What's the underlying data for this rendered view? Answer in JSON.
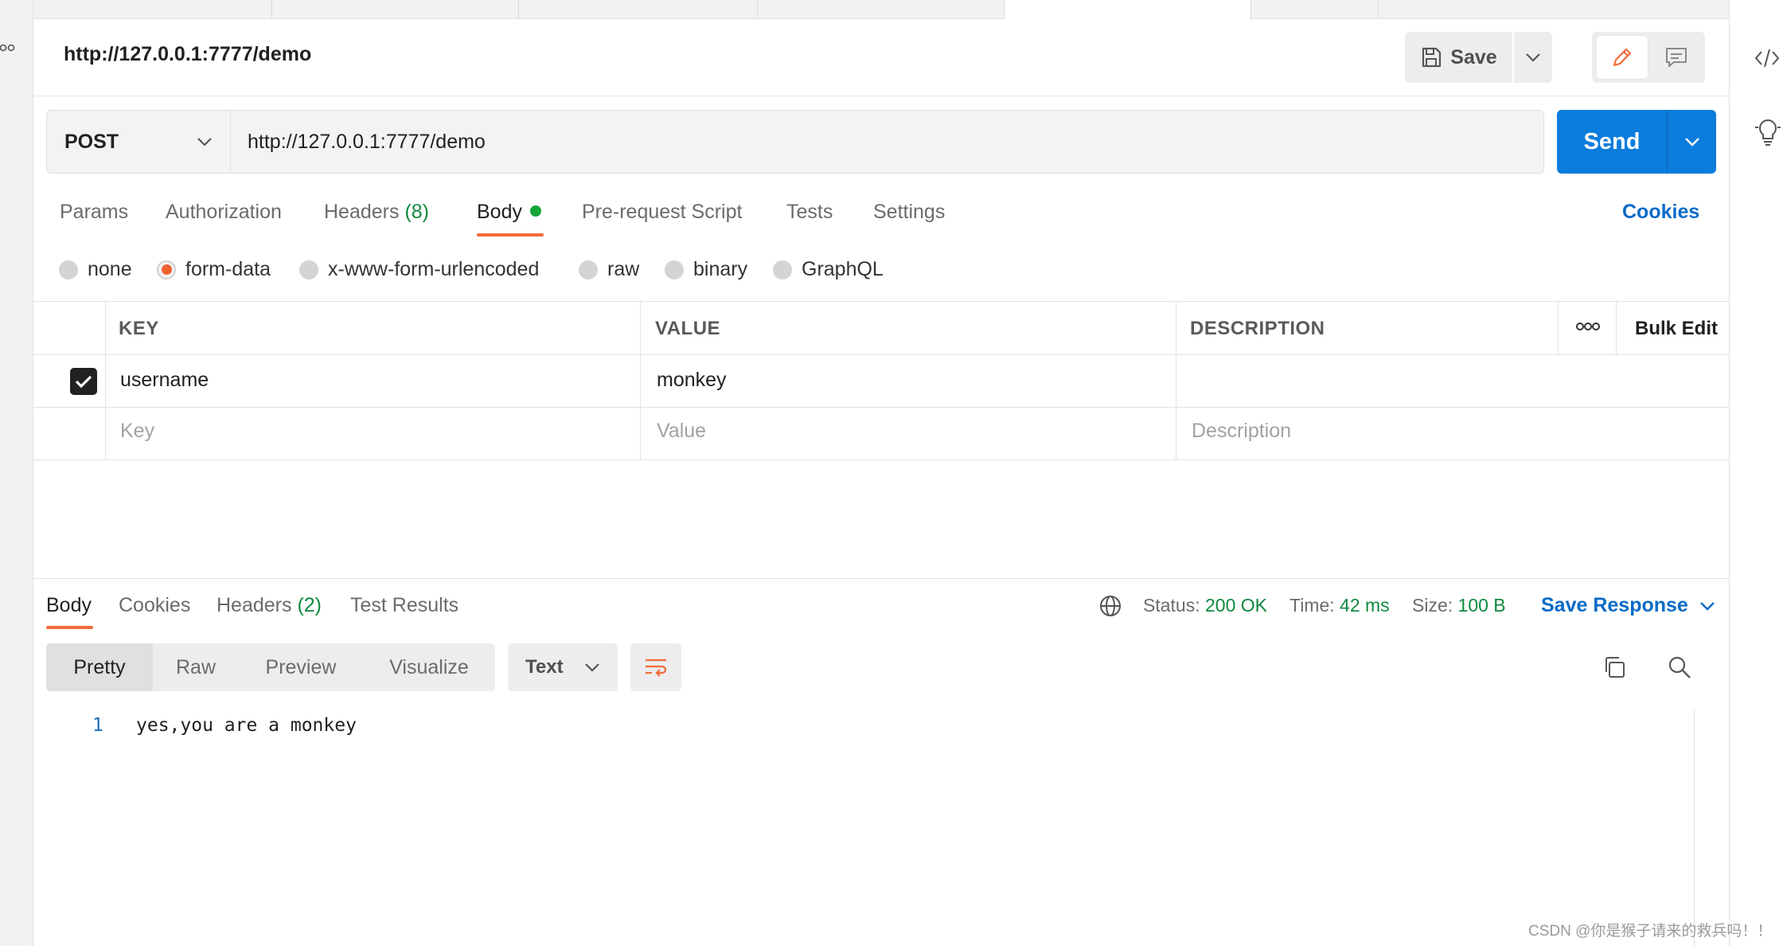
{
  "request": {
    "title": "http://127.0.0.1:7777/demo",
    "save_label": "Save",
    "method": "POST",
    "url": "http://127.0.0.1:7777/demo",
    "send_label": "Send"
  },
  "request_tabs": {
    "params": "Params",
    "authorization": "Authorization",
    "headers": "Headers",
    "headers_count": "(8)",
    "body": "Body",
    "prerequest": "Pre-request Script",
    "tests": "Tests",
    "settings": "Settings",
    "cookies": "Cookies"
  },
  "body_types": {
    "none": "none",
    "form_data": "form-data",
    "urlencoded": "x-www-form-urlencoded",
    "raw": "raw",
    "binary": "binary",
    "graphql": "GraphQL",
    "selected": "form-data"
  },
  "params_table": {
    "columns": {
      "key": "KEY",
      "value": "VALUE",
      "description": "DESCRIPTION"
    },
    "bulk_edit": "Bulk Edit",
    "rows": [
      {
        "checked": true,
        "key": "username",
        "value": "monkey",
        "description": ""
      }
    ],
    "placeholders": {
      "key": "Key",
      "value": "Value",
      "description": "Description"
    }
  },
  "response": {
    "tabs": {
      "body": "Body",
      "cookies": "Cookies",
      "headers": "Headers",
      "headers_count": "(2)",
      "test_results": "Test Results"
    },
    "status_label": "Status:",
    "status_value": "200 OK",
    "time_label": "Time:",
    "time_value": "42 ms",
    "size_label": "Size:",
    "size_value": "100 B",
    "save_response": "Save Response",
    "views": {
      "pretty": "Pretty",
      "raw": "Raw",
      "preview": "Preview",
      "visualize": "Visualize"
    },
    "format": "Text",
    "lines": [
      {
        "number": "1",
        "text": "yes,you are a monkey"
      }
    ]
  },
  "colors": {
    "accent_orange": "#f26b3a",
    "send_blue": "#0a7cdc",
    "link_blue": "#0a6bc7",
    "success_green": "#0d8a3e"
  },
  "watermark": "CSDN @你是猴子请来的救兵吗！！",
  "icons": [
    "save-icon",
    "chevron-down-icon",
    "pencil-icon",
    "comment-icon",
    "code-icon",
    "lightbulb-icon",
    "more-icon",
    "checkmark-icon",
    "globe-icon",
    "wrap-lines-icon",
    "copy-icon",
    "search-icon"
  ]
}
